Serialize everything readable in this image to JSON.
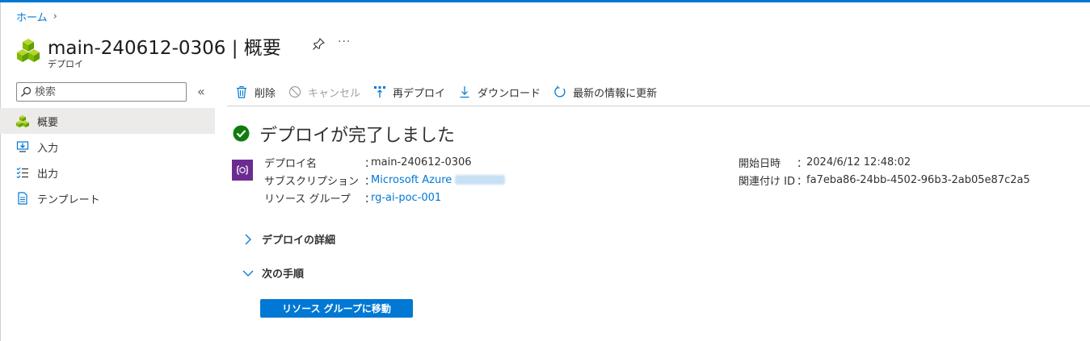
{
  "breadcrumb": {
    "home": "ホーム",
    "separator": "›"
  },
  "header": {
    "title": "main-240612-0306 | 概要",
    "subtitle": "デプロイ",
    "more": "···"
  },
  "sidebar": {
    "search_placeholder": "検索",
    "collapse": "«",
    "items": [
      {
        "label": "概要",
        "icon": "deployment-icon",
        "active": true
      },
      {
        "label": "入力",
        "icon": "input-icon"
      },
      {
        "label": "出力",
        "icon": "output-icon"
      },
      {
        "label": "テンプレート",
        "icon": "template-icon"
      }
    ]
  },
  "toolbar": {
    "delete": "削除",
    "cancel": "キャンセル",
    "redeploy": "再デプロイ",
    "download": "ダウンロード",
    "refresh": "最新の情報に更新"
  },
  "status": {
    "title": "デプロイが完了しました"
  },
  "details": {
    "left": [
      {
        "label": "デプロイ名",
        "sep": "：",
        "value": "main-240612-0306"
      },
      {
        "label": "サブスクリプション",
        "sep": "：",
        "value": "Microsoft Azure"
      },
      {
        "label": "リソース グループ",
        "sep": "：",
        "value": "rg-ai-poc-001"
      }
    ],
    "right": [
      {
        "label": "開始日時",
        "sep": "：",
        "value": "2024/6/12 12:48:02"
      },
      {
        "label": "関連付け ID",
        "sep": "：",
        "value": "fa7eba86-24bb-4502-96b3-2ab05e87c2a5"
      }
    ]
  },
  "sections": {
    "details": "デプロイの詳細",
    "next_steps": "次の手順"
  },
  "actions": {
    "go_to_resource_group": "リソース グループに移動"
  },
  "colors": {
    "accent": "#0078d4",
    "success": "#107c10",
    "deploy_icon": "#6b2c91"
  }
}
